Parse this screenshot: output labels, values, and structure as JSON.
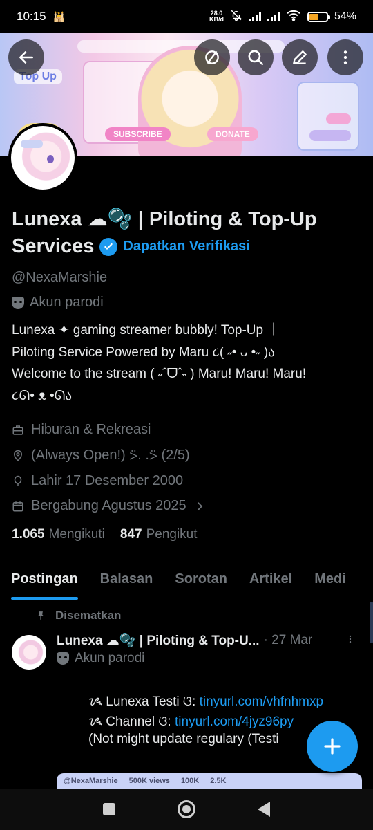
{
  "status_bar": {
    "time": "10",
    "time_suffix": ":15",
    "net_speed_value": "28.0",
    "net_speed_unit": "KB/d",
    "battery_percent": "54%",
    "battery_level": 0.54,
    "battery_color": "#f5a623"
  },
  "banner": {
    "topup_text": "Top Up",
    "subscribe_label": "SUBSCRIBE",
    "donate_label": "DONATE"
  },
  "toolbar": {
    "back_icon": "arrow-left-icon",
    "grok_icon": "slash-circle-icon",
    "search_icon": "search-icon",
    "edit_icon": "pencil-icon",
    "more_icon": "more-vertical-icon"
  },
  "profile": {
    "name_line1": "Lunexa ☁🫧 | Piloting & Top-Up",
    "name_line2": "Services",
    "get_verified": "Dapatkan Verifikasi",
    "handle": "@NexaMarshie",
    "parody_label": "Akun parodi",
    "bio": [
      "Lunexa ✦ gaming streamer bubbly! Top-Up ｜",
      "Piloting Service Powered by Maru ૮( ˶• ᴗ •˶ )ა",
      "Welcome to the stream ( ˶ˆᗜˆ˵ )  Maru! Maru! Maru!",
      "૮ᘏ• ᴥ •ᘏა"
    ],
    "category": "Hiburan & Rekreasi",
    "location": "(Always Open!) ⍩. .⍩ (2/5)",
    "birthday": "Lahir 17 Desember 2000",
    "joined": "Bergabung Agustus 2025",
    "following_count": "1.065",
    "following_label": "Mengikuti",
    "followers_count": "847",
    "followers_label": "Pengikut",
    "accent_color": "#1d9bf0"
  },
  "tabs": [
    {
      "label": "Postingan",
      "active": true
    },
    {
      "label": "Balasan",
      "active": false
    },
    {
      "label": "Sorotan",
      "active": false
    },
    {
      "label": "Artikel",
      "active": false
    },
    {
      "label": "Medi",
      "active": false
    }
  ],
  "pinned_post": {
    "pinned_label": "Disematkan",
    "author": "Lunexa ☁🫧 | Piloting & Top-U...",
    "date": "· 27 Mar",
    "parody_label": "Akun parodi",
    "line1_text": "ᝰ Lunexa Testi ଓ: ",
    "line1_link": "tinyurl.com/vhfnhmxp",
    "line2_text": "ᝰ Channel ଓ: ",
    "line2_link": "tinyurl.com/4jyz96py",
    "line3_text": "(Not might update regulary (Testi",
    "media_handle": "@NexaMarshie",
    "media_views": "500K views",
    "media_likes": "100K",
    "media_comments": "2.5K"
  }
}
